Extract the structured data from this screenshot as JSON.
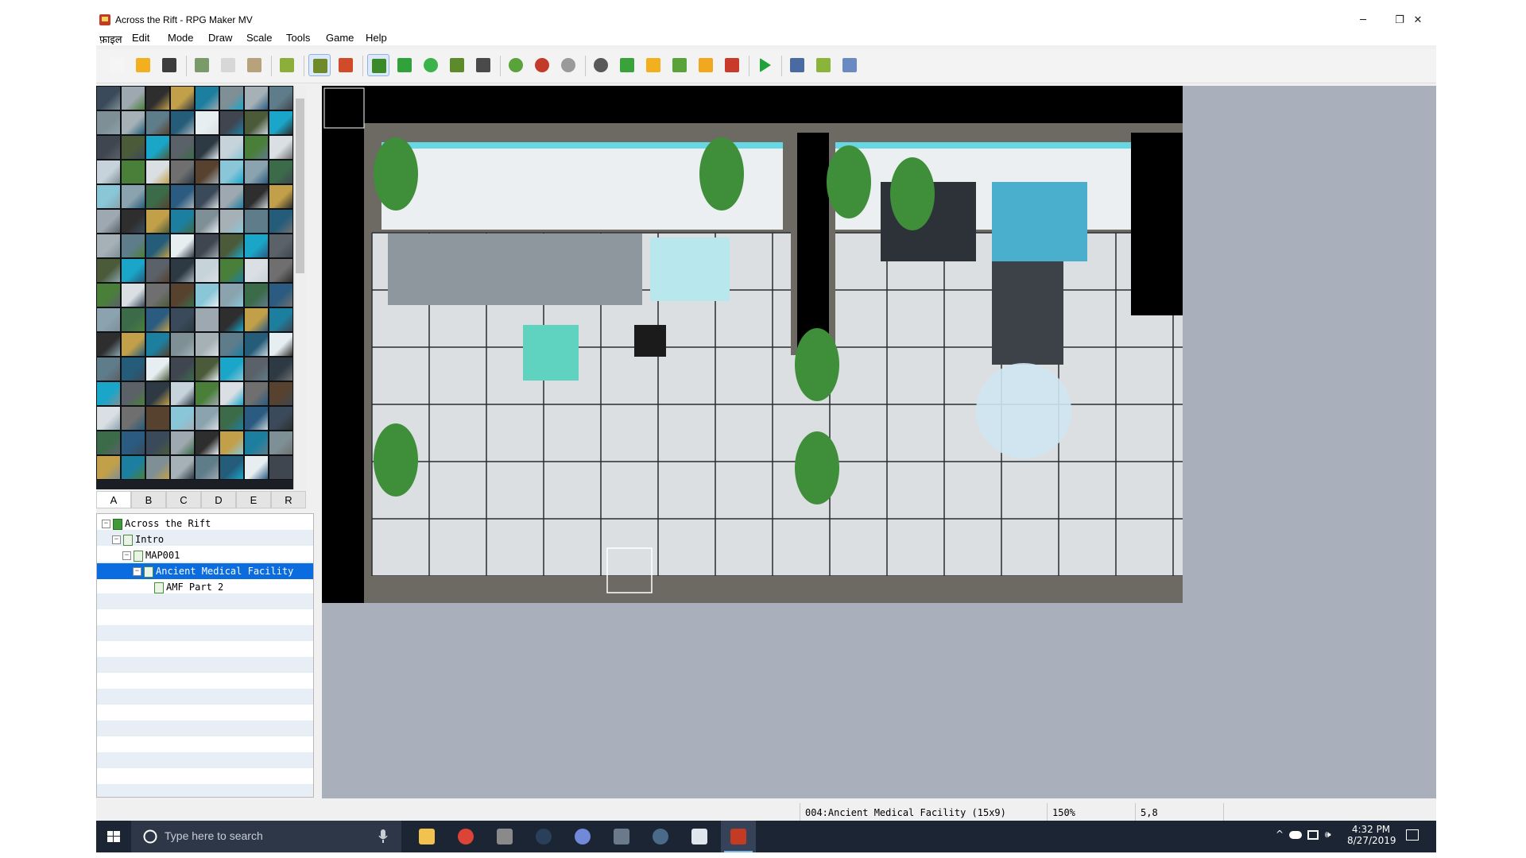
{
  "window": {
    "title": "Across the Rift - RPG Maker MV",
    "controls": {
      "minimize": "─",
      "restore": "❐",
      "close": "✕"
    }
  },
  "menu": [
    "फ़ाइल",
    "Edit",
    "Mode",
    "Draw",
    "Scale",
    "Tools",
    "Game",
    "Help"
  ],
  "toolbar": [
    {
      "name": "new-project-button",
      "icon": "new-document-icon",
      "color": "#f5f5f5"
    },
    {
      "name": "open-project-button",
      "icon": "open-folder-icon",
      "color": "#f2b01e"
    },
    {
      "name": "save-project-button",
      "icon": "floppy-disk-icon",
      "color": "#3c3c3c"
    },
    {
      "sep": true
    },
    {
      "name": "cut-button",
      "icon": "scissors-icon",
      "color": "#7a9a6a"
    },
    {
      "name": "copy-button",
      "icon": "copy-icon",
      "color": "#d7d7d7"
    },
    {
      "name": "paste-button",
      "icon": "clipboard-icon",
      "color": "#b8a27c"
    },
    {
      "sep": true
    },
    {
      "name": "undo-button",
      "icon": "undo-arrow-icon",
      "color": "#8cae3b"
    },
    {
      "sep": true
    },
    {
      "name": "map-mode-button",
      "icon": "map-mode-icon",
      "color": "#6f8a2a",
      "active": true
    },
    {
      "name": "event-mode-button",
      "icon": "event-mode-icon",
      "color": "#d14b2a"
    },
    {
      "sep": true
    },
    {
      "name": "pencil-button",
      "icon": "pencil-icon",
      "color": "#3a8a2a",
      "active": true
    },
    {
      "name": "rectangle-button",
      "icon": "rectangle-icon",
      "color": "#31a23b"
    },
    {
      "name": "ellipse-button",
      "icon": "ellipse-icon",
      "color": "#3cb34a"
    },
    {
      "name": "flood-fill-button",
      "icon": "flood-fill-icon",
      "color": "#5d8a2b"
    },
    {
      "name": "shadow-pen-button",
      "icon": "shadow-pen-icon",
      "color": "#4a4a4a"
    },
    {
      "sep": true
    },
    {
      "name": "zoom-in-button",
      "icon": "zoom-in-icon",
      "color": "#5aa23a"
    },
    {
      "name": "zoom-out-button",
      "icon": "zoom-out-icon",
      "color": "#c43a2a"
    },
    {
      "name": "actual-size-button",
      "icon": "actual-size-icon",
      "color": "#9a9a9a"
    },
    {
      "sep": true
    },
    {
      "name": "database-button",
      "icon": "gear-icon",
      "color": "#595959"
    },
    {
      "name": "plugin-manager-button",
      "icon": "puzzle-icon",
      "color": "#3aa23a"
    },
    {
      "name": "sound-test-button",
      "icon": "speaker-icon",
      "color": "#f2b01e"
    },
    {
      "name": "event-searcher-button",
      "icon": "search-icon",
      "color": "#5aa23a"
    },
    {
      "name": "resource-manager-button",
      "icon": "resource-folder-icon",
      "color": "#f2a81e"
    },
    {
      "name": "character-generator-button",
      "icon": "character-icon",
      "color": "#c93a2a"
    },
    {
      "sep": true
    },
    {
      "name": "playtest-button",
      "icon": "play-icon",
      "color": "#20a13a"
    },
    {
      "sep": true
    },
    {
      "name": "deploy-button",
      "icon": "deploy-box-icon",
      "color": "#4a6aa2"
    },
    {
      "name": "package-button",
      "icon": "package-icon",
      "color": "#8ab43a"
    },
    {
      "name": "steam-package-button",
      "icon": "steam-box-icon",
      "color": "#6a8ac2"
    }
  ],
  "tileset_tabs": [
    "A",
    "B",
    "C",
    "D",
    "E",
    "R"
  ],
  "tileset_active_tab": "A",
  "map_tree": [
    {
      "label": "Across the Rift",
      "level": 0,
      "expander": "⊟",
      "icon": "project-icon",
      "selected": false
    },
    {
      "label": "Intro",
      "level": 1,
      "expander": "⊟",
      "icon": "map-icon",
      "selected": false
    },
    {
      "label": "MAP001",
      "level": 2,
      "expander": "⊟",
      "icon": "map-icon",
      "selected": false
    },
    {
      "label": "Ancient Medical Facility",
      "level": 3,
      "expander": "⊟",
      "icon": "map-icon",
      "selected": true
    },
    {
      "label": "AMF Part 2",
      "level": 4,
      "expander": "",
      "icon": "map-icon",
      "selected": false
    }
  ],
  "status": {
    "map": "004:Ancient Medical Facility (15x9)",
    "zoom": "150%",
    "coords": "5,8"
  },
  "map": {
    "cols": 15,
    "rows": 9
  },
  "taskbar": {
    "search_placeholder": "Type here to search",
    "apps": [
      {
        "name": "taskbar-file-explorer",
        "icon": "folder-icon",
        "color": "#f2c14e",
        "active": false
      },
      {
        "name": "taskbar-chrome",
        "icon": "chrome-icon",
        "color": "#db4437",
        "active": false
      },
      {
        "name": "taskbar-app-3",
        "icon": "app-icon",
        "color": "#8a8a8a",
        "active": false
      },
      {
        "name": "taskbar-steam",
        "icon": "steam-icon",
        "color": "#2a3f5a",
        "active": false
      },
      {
        "name": "taskbar-discord",
        "icon": "discord-icon",
        "color": "#7289da",
        "active": false
      },
      {
        "name": "taskbar-notes",
        "icon": "notes-icon",
        "color": "#6a7a8a",
        "active": false
      },
      {
        "name": "taskbar-steam-2",
        "icon": "steam-icon",
        "color": "#4a6a8a",
        "active": false
      },
      {
        "name": "taskbar-photos",
        "icon": "photos-icon",
        "color": "#dfe6ee",
        "active": false
      },
      {
        "name": "taskbar-rpg-maker",
        "icon": "rpg-maker-icon",
        "color": "#c23b22",
        "active": true
      }
    ],
    "time": "4:32 PM",
    "date": "8/27/2019"
  }
}
